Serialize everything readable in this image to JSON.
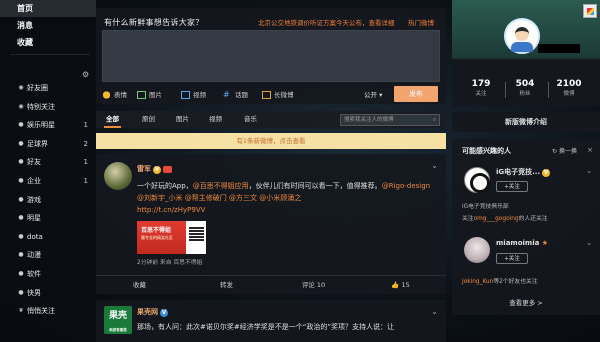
{
  "nav": {
    "home": "首页",
    "messages": "消息",
    "favorites": "收藏",
    "groups": [
      {
        "label": "好友圈",
        "count": ""
      },
      {
        "label": "特别关注",
        "count": ""
      },
      {
        "label": "娱乐明星",
        "count": "1"
      },
      {
        "label": "足球界",
        "count": "2"
      },
      {
        "label": "好友",
        "count": "1"
      },
      {
        "label": "企业",
        "count": "1"
      },
      {
        "label": "游戏",
        "count": ""
      },
      {
        "label": "明星",
        "count": ""
      },
      {
        "label": "dota",
        "count": ""
      },
      {
        "label": "动漫",
        "count": ""
      },
      {
        "label": "软件",
        "count": ""
      },
      {
        "label": "快男",
        "count": ""
      },
      {
        "label": "悄悄关注",
        "count": ""
      }
    ]
  },
  "compose": {
    "prompt": "有什么新鲜事想告诉大家？",
    "hot_topic": "北京公交地铁调价听证方案今天公布，查看详细",
    "hot_link": "热门微博",
    "tools": [
      "表情",
      "图片",
      "视频",
      "话题",
      "长微博"
    ],
    "visibility": "公开",
    "submit": "发布"
  },
  "feed_tabs": {
    "tabs": [
      "全部",
      "原创",
      "图片",
      "视频",
      "音乐"
    ],
    "search_placeholder": "搜索我关注人的微博"
  },
  "new_posts": "有1条新微博，点击查看",
  "post1": {
    "author": "雷军",
    "text_a": "一个好玩的App，",
    "mention1": "@百思不得姐应用",
    "text_b": "，伙伴儿们有时间可以看一下，值得推荐。",
    "mention2": "@Rigo-design",
    "mention3": "@刘新宇_小米",
    "mention4": "@帮主修破门",
    "mention5": "@方三文",
    "mention6": "@小米顾涌之",
    "link": "http://t.cn/zHyP9VV",
    "image_title": "百思不得姐",
    "image_sub": "最专业的搞笑社区",
    "meta": "2分钟前 来自 百思不得姐",
    "actions": [
      "收藏",
      "转发",
      "评论 10",
      "15"
    ]
  },
  "post2": {
    "author": "果壳网",
    "avatar_text": "果壳",
    "avatar_sub": "科技有意思",
    "text": "那场，有人问：此次#诺贝尔奖#经济学奖是不是一个“政治的”奖项？支持人说：让"
  },
  "profile": {
    "stats": [
      {
        "num": "179",
        "label": "关注"
      },
      {
        "num": "504",
        "label": "粉丝"
      },
      {
        "num": "2100",
        "label": "微博"
      }
    ]
  },
  "guide": "新版微博介绍",
  "recommend": {
    "title": "可能感兴趣的人",
    "change": "换一换",
    "close": "×",
    "users": [
      {
        "name": "iG电子竞技...",
        "follow": "+关注",
        "desc1": "iG电子竞技俱乐部",
        "desc2_pre": "关注",
        "desc2_hl": "omg___gogoing",
        "desc2_post": "的人还关注"
      },
      {
        "name": "miamoimia",
        "follow": "+关注",
        "desc1_hl": "Joking_Kun",
        "desc1_post": "等2个好友也关注"
      }
    ],
    "more": "查看更多 >"
  }
}
